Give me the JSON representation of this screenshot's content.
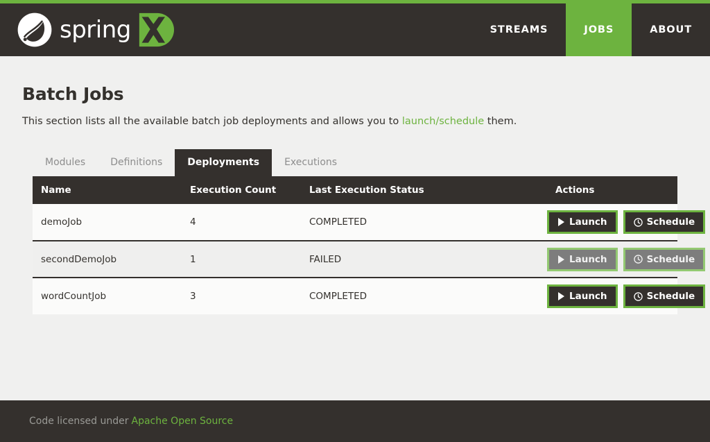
{
  "theme": {
    "accent_green": "#6db33f",
    "dark": "#34302d",
    "page_bg": "#f0f0ef",
    "status_completed_color": "#6b8c52",
    "status_failed_color": "#b04a42"
  },
  "header": {
    "brand_name": "spring",
    "brand_badge": "XD",
    "nav": [
      {
        "label": "STREAMS",
        "active": false
      },
      {
        "label": "JOBS",
        "active": true
      },
      {
        "label": "ABOUT",
        "active": false
      }
    ]
  },
  "main": {
    "title": "Batch Jobs",
    "description_before": "This section lists all the available batch job deployments and allows you to ",
    "link_launch": "launch",
    "description_slash": "/",
    "link_schedule": "schedule",
    "description_after": " them.",
    "tabs": [
      {
        "label": "Modules",
        "active": false
      },
      {
        "label": "Definitions",
        "active": false
      },
      {
        "label": "Deployments",
        "active": true
      },
      {
        "label": "Executions",
        "active": false
      }
    ],
    "table": {
      "columns": [
        "Name",
        "Execution Count",
        "Last Execution Status",
        "Actions"
      ],
      "rows": [
        {
          "name": "demoJob",
          "execution_count": "4",
          "status": "COMPLETED",
          "status_state": "completed",
          "launch_label": "Launch",
          "schedule_label": "Schedule",
          "launch_enabled": true,
          "schedule_enabled": true,
          "details_enabled": true
        },
        {
          "name": "secondDemoJob",
          "execution_count": "1",
          "status": "FAILED",
          "status_state": "failed",
          "launch_label": "Launch",
          "schedule_label": "Schedule",
          "launch_enabled": false,
          "schedule_enabled": false,
          "details_enabled": true
        },
        {
          "name": "wordCountJob",
          "execution_count": "3",
          "status": "COMPLETED",
          "status_state": "completed",
          "launch_label": "Launch",
          "schedule_label": "Schedule",
          "launch_enabled": true,
          "schedule_enabled": true,
          "details_enabled": true
        }
      ]
    }
  },
  "footer": {
    "text": "Code licensed under",
    "link": "Apache Open Source"
  }
}
